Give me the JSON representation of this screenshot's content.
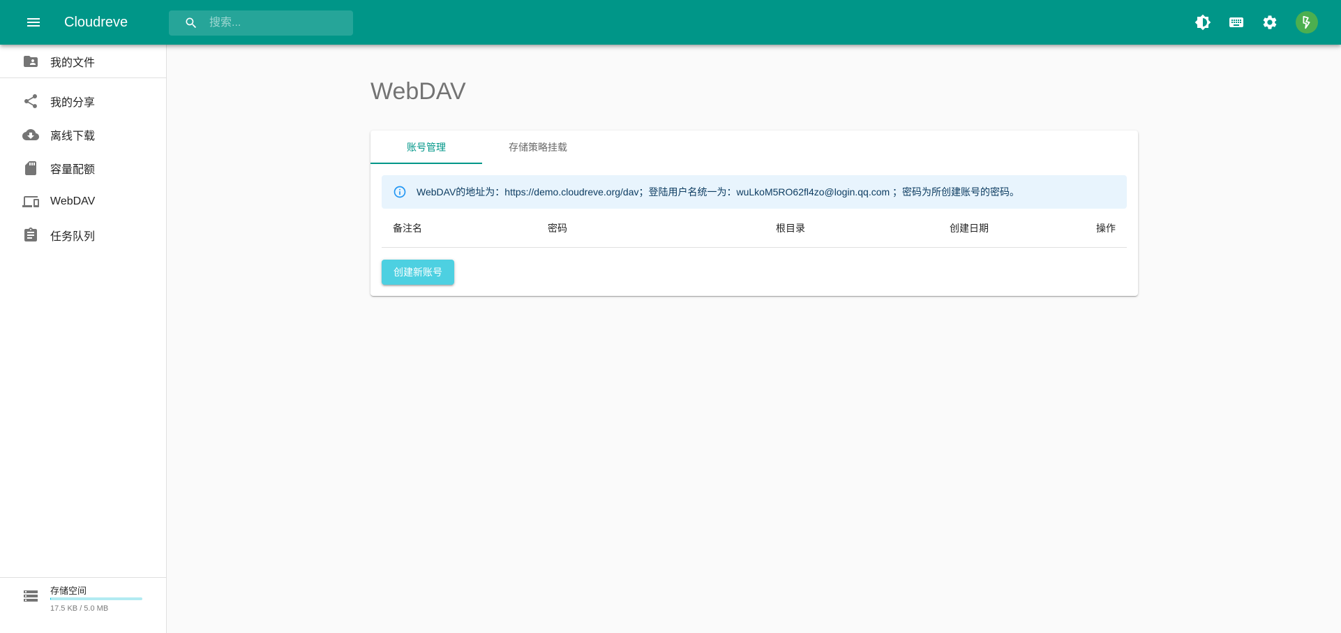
{
  "app": {
    "title": "Cloudreve",
    "accent_color": "#009688"
  },
  "search": {
    "placeholder": "搜索..."
  },
  "topbar_icons": [
    "brightness-icon",
    "keyboard-icon",
    "settings-icon",
    "avatar"
  ],
  "sidebar": {
    "items": [
      {
        "label": "我的文件",
        "icon": "folder-shared-icon"
      },
      {
        "label": "我的分享",
        "icon": "share-icon"
      },
      {
        "label": "离线下载",
        "icon": "cloud-download-icon"
      },
      {
        "label": "容量配额",
        "icon": "sd-card-icon"
      },
      {
        "label": "WebDAV",
        "icon": "devices-icon"
      },
      {
        "label": "任务队列",
        "icon": "assignment-icon"
      }
    ],
    "storage": {
      "title": "存储空间",
      "usage": "17.5 KB / 5.0 MB",
      "used_fraction": 0.0034
    }
  },
  "main": {
    "title": "WebDAV",
    "tabs": [
      {
        "label": "账号管理",
        "active": true
      },
      {
        "label": "存储策略挂载",
        "active": false
      }
    ],
    "alert": {
      "text": "WebDAV的地址为：https://demo.cloudreve.org/dav；登陆用户名统一为：wuLkoM5RO62fl4zo@login.qq.com ；密码为所创建账号的密码。"
    },
    "table": {
      "columns": [
        "备注名",
        "密码",
        "根目录",
        "创建日期",
        "操作"
      ]
    },
    "create_button": "创建新账号"
  }
}
